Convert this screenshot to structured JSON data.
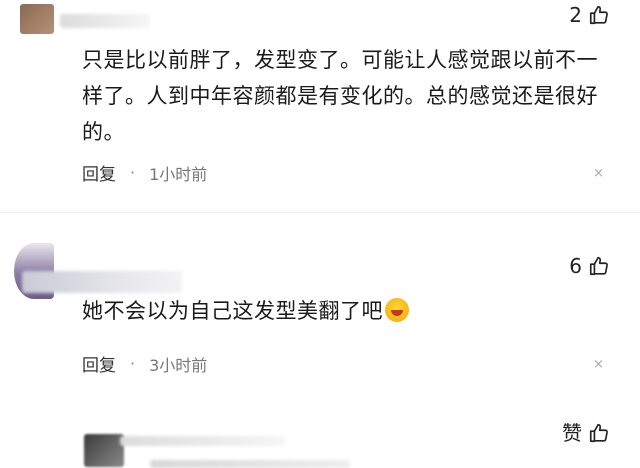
{
  "comments": [
    {
      "text": "只是比以前胖了，发型变了。可能让人感觉跟以前不一样了。人到中年容颜都是有变化的。总的感觉还是很好的。",
      "likes": "2",
      "reply_label": "回复",
      "separator": "·",
      "time": "1小时前",
      "close": "×"
    },
    {
      "text": "她不会以为自己这发型美翻了吧",
      "likes": "6",
      "reply_label": "回复",
      "separator": "·",
      "time": "3小时前",
      "close": "×",
      "emoji": "laughing-crying-emoji"
    },
    {
      "likes": "赞"
    }
  ],
  "icons": {
    "like": "thumbs-up-icon",
    "close": "close-icon"
  },
  "colors": {
    "text": "#1a1a1a",
    "meta": "#777777",
    "divider": "#efefef"
  }
}
